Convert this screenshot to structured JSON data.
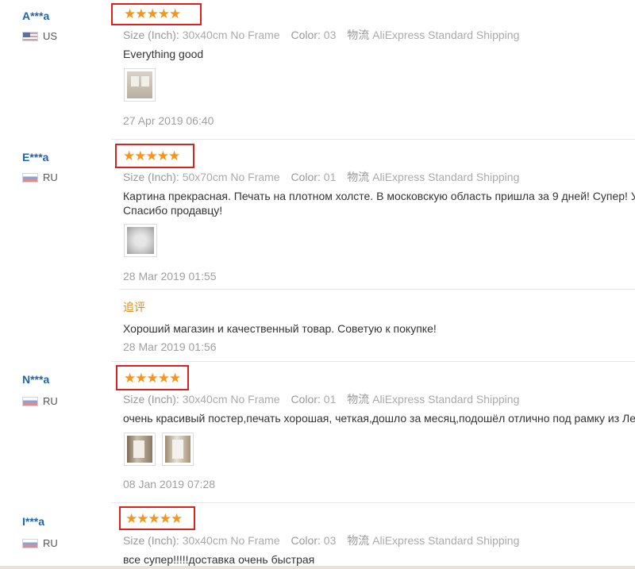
{
  "labels": {
    "size": "Size (Inch):",
    "color": "Color:",
    "shipping": "物流"
  },
  "reviews": [
    {
      "user": "A***a",
      "country": "US",
      "stars": "★★★★★",
      "size": "30x40cm No Frame",
      "color": "03",
      "shipping": "AliExpress Standard Shipping",
      "text": "Everything good",
      "text2": "",
      "date": "27 Apr 2019 06:40"
    },
    {
      "user": "E***a",
      "country": "RU",
      "stars": "★★★★★",
      "size": "50x70cm No Frame",
      "color": "01",
      "shipping": "AliExpress Standard Shipping",
      "text": "Картина прекрасная. Печать на плотном холсте. В московскую область пришла за 9 дней! Супер! У",
      "text2": "Спасибо продавцу!",
      "date": "28 Mar 2019 01:55",
      "followup": {
        "label": "追评",
        "text": "Хороший магазин и качественный товар. Советую к покупке!",
        "date": "28 Mar 2019 01:56"
      }
    },
    {
      "user": "N***a",
      "country": "RU",
      "stars": "★★★★★",
      "size": "30x40cm No Frame",
      "color": "01",
      "shipping": "AliExpress Standard Shipping",
      "text": "очень красивый постер,печать хорошая, четкая,дошло за месяц,подошёл отлично под рамку из Ле",
      "text2": "",
      "date": "08 Jan 2019 07:28"
    },
    {
      "user": "I***a",
      "country": "RU",
      "stars": "★★★★★",
      "size": "30x40cm No Frame",
      "color": "03",
      "shipping": "AliExpress Standard Shipping",
      "text": "все супер!!!!!доставка очень быстрая",
      "text2": ""
    }
  ]
}
